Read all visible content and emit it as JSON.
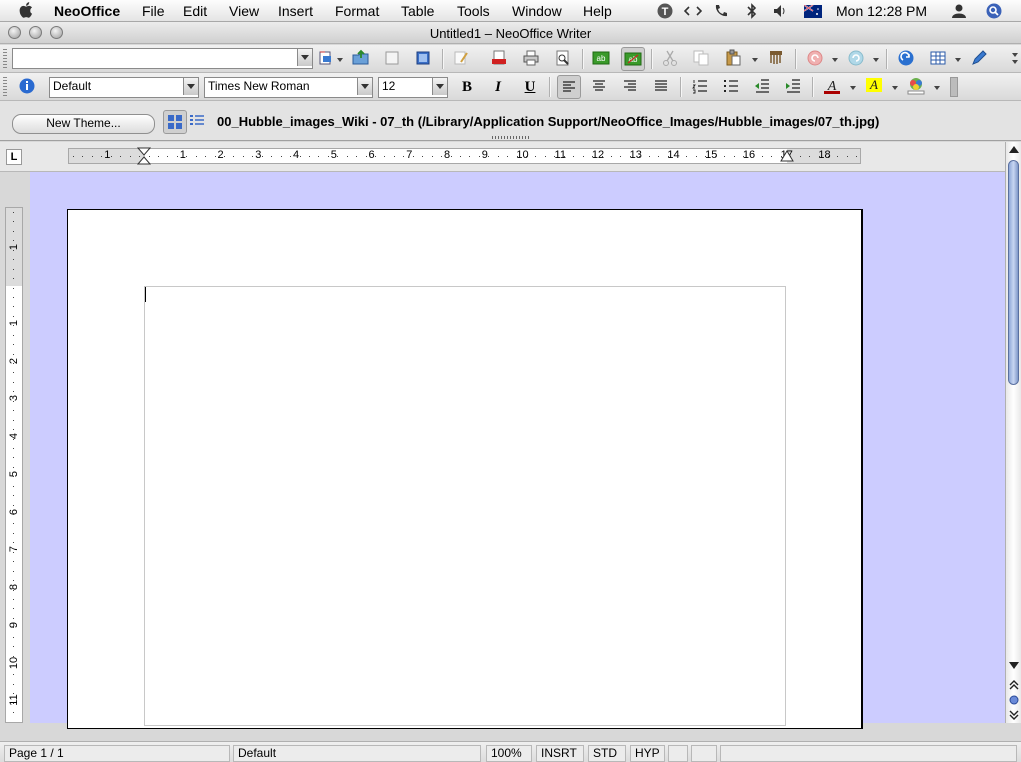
{
  "menubar": {
    "app_name": "NeoOffice",
    "items": [
      "File",
      "Edit",
      "View",
      "Insert",
      "Format",
      "Table",
      "Tools",
      "Window",
      "Help"
    ],
    "clock": "Mon 12:28 PM",
    "tray_icons": [
      "text-input-icon",
      "script-icon",
      "phone-icon",
      "bluetooth-icon",
      "volume-icon",
      "flag-icon",
      "user-icon",
      "spotlight-icon"
    ]
  },
  "window": {
    "title": "Untitled1 – NeoOffice Writer"
  },
  "formatting": {
    "paragraph_style": "Default",
    "font_name": "Times New Roman",
    "font_size": "12",
    "bold_label": "B",
    "italic_label": "I",
    "underline_label": "U",
    "font_color": "#aa0000",
    "highlight_color": "#ffff00"
  },
  "gallery": {
    "new_theme_label": "New Theme...",
    "path": "00_Hubble_images_Wiki - 07_th (/Library/Application Support/NeoOffice_Images/Hubble_images/07_th.jpg)"
  },
  "ruler": {
    "h_numbers": [
      "1",
      "1",
      "2",
      "3",
      "4",
      "5",
      "6",
      "7",
      "8",
      "9",
      "10",
      "11",
      "12",
      "13",
      "14",
      "15",
      "16",
      "17",
      "18"
    ],
    "v_numbers": [
      "1",
      "1",
      "2",
      "3",
      "4",
      "5",
      "6",
      "7",
      "8",
      "9",
      "10",
      "11"
    ],
    "tab_corner": "L"
  },
  "statusbar": {
    "page": "Page 1 / 1",
    "style": "Default",
    "zoom": "100%",
    "insert_mode": "INSRT",
    "selection_mode": "STD",
    "hyperlink_mode": "HYP"
  }
}
